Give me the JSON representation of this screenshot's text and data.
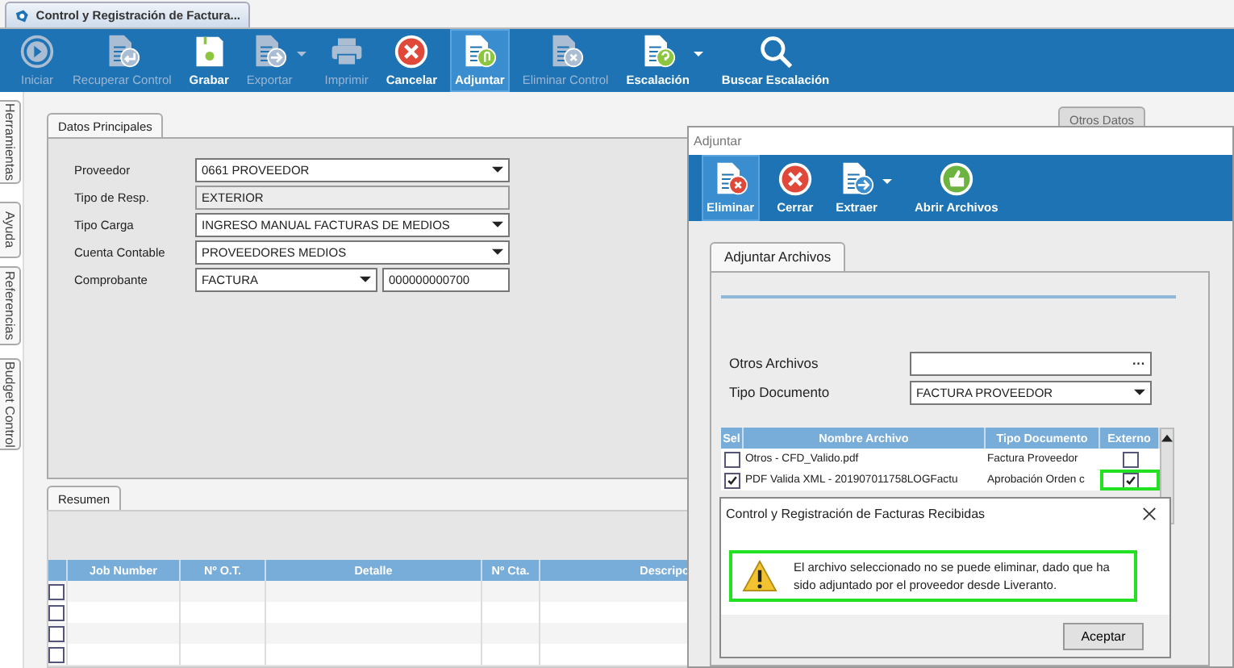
{
  "document_tab": {
    "title": "Control y Registración de Factura...",
    "selected": true
  },
  "toolbar": [
    {
      "label": "Iniciar",
      "kind": "play",
      "disabled": true,
      "selected": false,
      "dropdown": false
    },
    {
      "label": "Recuperar Control",
      "kind": "doc-return",
      "disabled": true,
      "selected": false,
      "dropdown": false
    },
    {
      "label": "Grabar",
      "kind": "save",
      "disabled": false,
      "selected": false,
      "dropdown": false
    },
    {
      "label": "Exportar",
      "kind": "doc-export",
      "disabled": true,
      "selected": false,
      "dropdown": true
    },
    {
      "label": "Imprimir",
      "kind": "print",
      "disabled": true,
      "selected": false,
      "dropdown": false
    },
    {
      "label": "Cancelar",
      "kind": "cancel",
      "disabled": false,
      "selected": false,
      "dropdown": false
    },
    {
      "label": "Adjuntar",
      "kind": "attach",
      "disabled": false,
      "selected": true,
      "dropdown": false
    },
    {
      "label": "Eliminar Control",
      "kind": "doc-delete",
      "disabled": true,
      "selected": false,
      "dropdown": false
    },
    {
      "label": "Escalación",
      "kind": "doc-help",
      "disabled": false,
      "selected": false,
      "dropdown": true
    },
    {
      "label": "Buscar Escalación",
      "kind": "search",
      "disabled": false,
      "selected": false,
      "dropdown": false
    }
  ],
  "side_tabs": [
    "Herramientas",
    "Ayuda",
    "Referencias",
    "Budget Control"
  ],
  "main_tabs": [
    {
      "label": "Datos Principales",
      "selected": true
    },
    {
      "label": "Otros Datos",
      "selected": false
    }
  ],
  "form": [
    {
      "label": "Proveedor",
      "kind": "dropdown",
      "value": "0661 PROVEEDOR"
    },
    {
      "label": "Tipo de Resp.",
      "kind": "readonly",
      "value": "EXTERIOR"
    },
    {
      "label": "Tipo Carga",
      "kind": "dropdown",
      "value": "INGRESO MANUAL FACTURAS DE MEDIOS"
    },
    {
      "label": "Cuenta Contable",
      "kind": "dropdown",
      "value": "PROVEEDORES MEDIOS"
    },
    {
      "label": "Comprobante",
      "kind": "dropdown_number",
      "value": "FACTURA",
      "number": "000000000700"
    }
  ],
  "resumen": {
    "tab": "Resumen",
    "columns": [
      "Job Number",
      "Nº O.T.",
      "Detalle",
      "Nº Cta.",
      "Descripc"
    ],
    "rows": [
      {
        "checked": false
      },
      {
        "checked": false
      },
      {
        "checked": false
      },
      {
        "checked": false
      }
    ]
  },
  "adjuntar_dialog": {
    "title": "Adjuntar",
    "toolbar": [
      {
        "label": "Eliminar",
        "kind": "doc-delete",
        "disabled": false,
        "selected": true,
        "dropdown": false
      },
      {
        "label": "Cerrar",
        "kind": "cancel",
        "disabled": false,
        "selected": false,
        "dropdown": false
      },
      {
        "label": "Extraer",
        "kind": "doc-export",
        "disabled": false,
        "selected": false,
        "dropdown": true
      },
      {
        "label": "Abrir Archivos",
        "kind": "thumb",
        "disabled": false,
        "selected": false,
        "dropdown": false
      }
    ],
    "tab": "Adjuntar Archivos",
    "otros_archivos": {
      "label": "Otros Archivos",
      "button": "···"
    },
    "tipo_documento": {
      "label": "Tipo Documento",
      "value": "FACTURA PROVEEDOR"
    },
    "grid": {
      "columns": [
        "Sel",
        "Nombre Archivo",
        "Tipo Documento",
        "Externo"
      ],
      "rows": [
        {
          "checked": false,
          "name": "Otros - CFD_Valido.pdf",
          "type": "Factura Proveedor",
          "external": false,
          "highlighted": false
        },
        {
          "checked": true,
          "name": "PDF Valida XML - 201907011758LOGFactu",
          "type": "Aprobación Orden c",
          "external": true,
          "highlighted": true
        }
      ]
    }
  },
  "message_box": {
    "title": "Control y Registración de Facturas Recibidas",
    "message": "El archivo seleccionado no se puede eliminar, dado que ha sido adjuntado por el proveedor desde Liveranto.",
    "highlighted": true,
    "button": "Aceptar"
  }
}
